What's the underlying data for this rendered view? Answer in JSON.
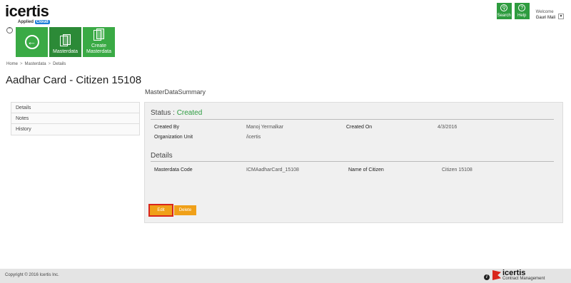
{
  "header": {
    "logo_text": "icertis",
    "logo_sub_prefix": "Applied",
    "logo_sub_badge": "Cloud",
    "search_label": "Search",
    "help_label": "Help",
    "welcome_label": "Welcome",
    "user_name": "Gauri Mali"
  },
  "tiles": {
    "masterdata_label": "Masterdata",
    "create_line1": "Create",
    "create_line2": "Masterdata"
  },
  "breadcrumb": [
    "Home",
    "Masterdata",
    "Details"
  ],
  "page_title": "Aadhar Card - Citizen 15108",
  "sidebar": {
    "items": [
      {
        "label": "Details"
      },
      {
        "label": "Notes"
      },
      {
        "label": "History"
      }
    ]
  },
  "summary": {
    "heading": "MasterDataSummary",
    "status_label": "Status : ",
    "status_value": "Created",
    "created_by_label": "Created By",
    "created_by_value": "Manoj Yermalkar",
    "created_on_label": "Created On",
    "created_on_value": "4/3/2016",
    "org_unit_label": "Organization Unit",
    "org_unit_value": "/icertis",
    "details_title": "Details",
    "code_label": "Masterdata Code",
    "code_value": "ICMAadharCard_15108",
    "citizen_label": "Name of Citizen",
    "citizen_value": "Citizen 15108",
    "edit_label": "Edit",
    "delete_label": "Delete"
  },
  "footer": {
    "copyright": "Copyright © 2016 Icertis Inc.",
    "logo_text": "icertis",
    "logo_sub": "Contract Management"
  },
  "colors": {
    "accent_green": "#3aaa45",
    "status_green": "#2c9c40",
    "button_orange": "#f0a018",
    "highlight_red": "#d9261c"
  }
}
